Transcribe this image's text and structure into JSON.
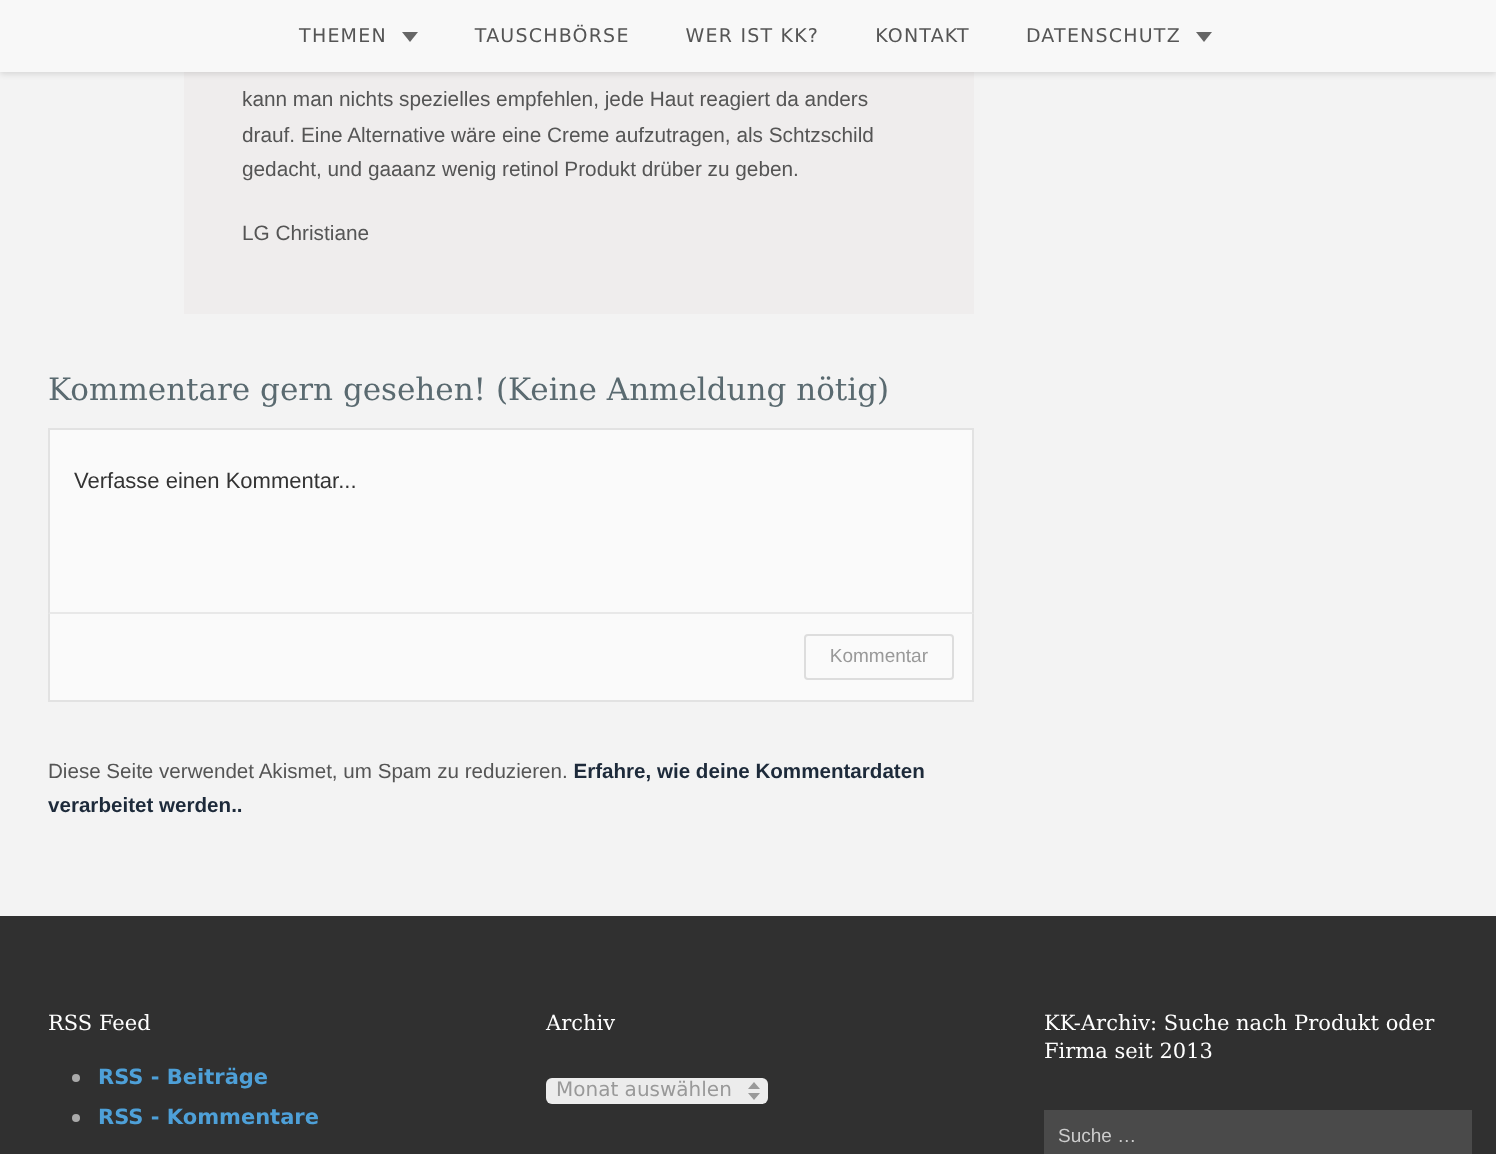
{
  "nav": [
    {
      "label": "THEMEN",
      "has_dropdown": true
    },
    {
      "label": "TAUSCHBÖRSE",
      "has_dropdown": false
    },
    {
      "label": "WER IST KK?",
      "has_dropdown": false
    },
    {
      "label": "KONTAKT",
      "has_dropdown": false
    },
    {
      "label": "DATENSCHUTZ",
      "has_dropdown": true
    }
  ],
  "quote": {
    "paragraphs": [
      "kann man nichts spezielles empfehlen, jede Haut reagiert da anders drauf. Eine Alternative wäre eine Creme aufzutragen, als Schtzschild gedacht, und gaaanz wenig retinol Produkt drüber zu geben.",
      "LG Christiane"
    ]
  },
  "comments": {
    "title": "Kommentare gern gesehen! (Keine Anmeldung nötig)",
    "placeholder": "Verfasse einen Kommentar...",
    "submit": "Kommentar"
  },
  "akismet": {
    "text": "Diese Seite verwendet Akismet, um Spam zu reduzieren. ",
    "link": "Erfahre, wie deine Kommentardaten verarbeitet werden.."
  },
  "footer": {
    "rss": {
      "title": "RSS Feed",
      "links": [
        "RSS - Beiträge",
        "RSS - Kommentare"
      ]
    },
    "archive": {
      "title": "Archiv",
      "select": "Monat auswählen"
    },
    "search": {
      "title": "KK-Archiv: Suche nach Produkt oder Firma seit 2013",
      "placeholder": "Suche …"
    }
  }
}
